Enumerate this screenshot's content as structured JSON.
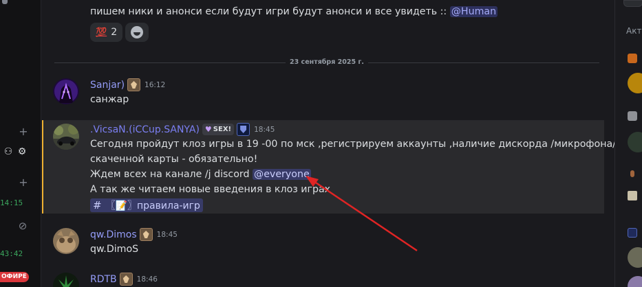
{
  "leftbar": {
    "times": [
      "14:15",
      "43:42"
    ],
    "badge": "ОФИРЕ"
  },
  "top_message": {
    "text": "пишем ники и анонси если будут игри будут анонси и все увидеть ::",
    "mention": "@Human",
    "reactions": [
      {
        "emoji": "💯",
        "count": "2"
      }
    ]
  },
  "date_divider": "23 сентября 2025 г.",
  "messages": [
    {
      "author": "Sanjar)",
      "author_color": "#949cf7",
      "time": "16:12",
      "lines": [
        "санжар"
      ]
    },
    {
      "author": ".VicsaN.(iCCup.SANYA)",
      "author_color": "#7b7ff2",
      "tag": "SEX!",
      "time": "18:45",
      "lines": [
        "Сегодня пройдут клоз игры в 19 -00 по мск ,регистрируем аккаунты ,наличие дискорда /микрофона/",
        "скаченной карты - обязательно!",
        "Ждем всех на канале /j discord",
        "А так же  читаем новые введения  в клоз играх"
      ],
      "mention": "@everyone",
      "channel": "〖📝〗правила-игр"
    },
    {
      "author": "qw.Dimos",
      "author_color": "#949cf7",
      "time": "18:45",
      "lines": [
        "qw.DimoS"
      ]
    },
    {
      "author": "RDTB",
      "author_color": "#949cf7",
      "time": "18:46",
      "lines": []
    }
  ],
  "rightbar": {
    "label": "Акт"
  },
  "colors": {
    "accent": "#5865f2",
    "highlight_border": "#f0b232",
    "arrow": "#e02424"
  }
}
